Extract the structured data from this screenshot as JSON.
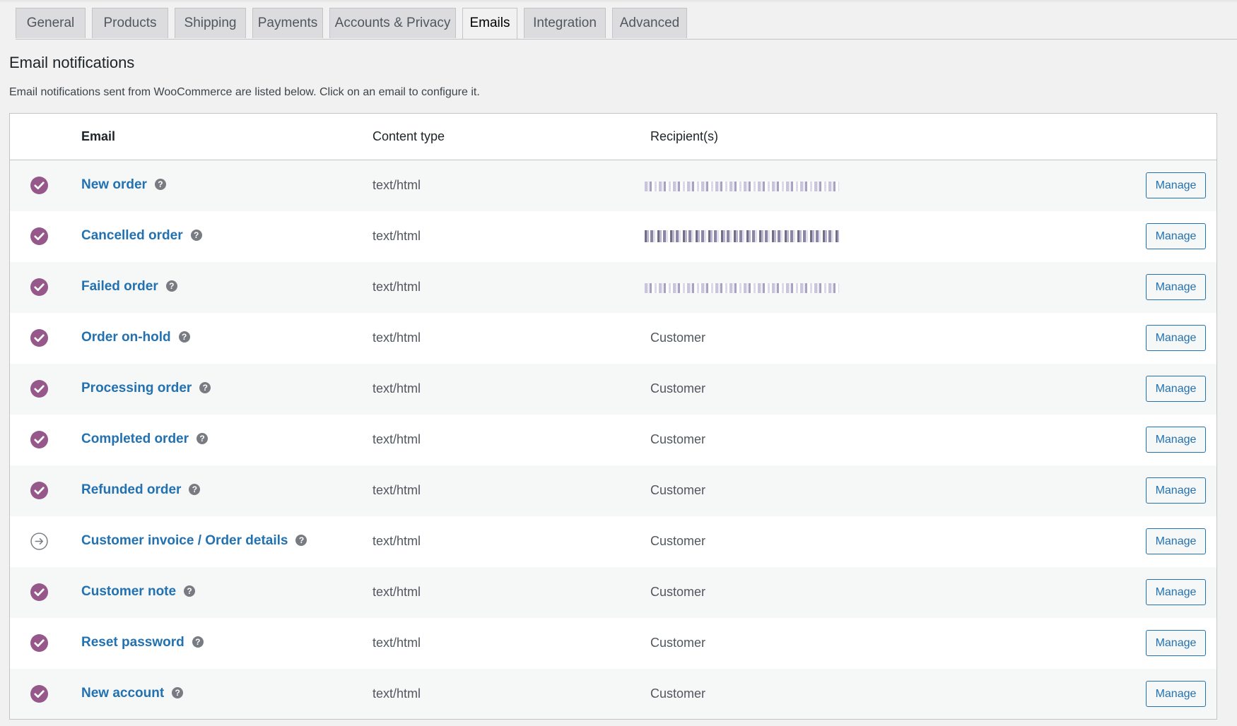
{
  "tabs": [
    {
      "label": "General"
    },
    {
      "label": "Products"
    },
    {
      "label": "Shipping"
    },
    {
      "label": "Payments"
    },
    {
      "label": "Accounts & Privacy"
    },
    {
      "label": "Emails"
    },
    {
      "label": "Integration"
    },
    {
      "label": "Advanced"
    }
  ],
  "active_tab": "Emails",
  "page": {
    "title": "Email notifications",
    "description": "Email notifications sent from WooCommerce are listed below. Click on an email to configure it."
  },
  "table": {
    "headers": {
      "email": "Email",
      "content_type": "Content type",
      "recipients": "Recipient(s)"
    },
    "help_glyph": "?",
    "manage_label": "Manage",
    "rows": [
      {
        "name": "New order",
        "status": "enabled",
        "content_type": "text/html",
        "recipient": "",
        "recipient_redacted": true
      },
      {
        "name": "Cancelled order",
        "status": "enabled",
        "content_type": "text/html",
        "recipient": "",
        "recipient_redacted": true
      },
      {
        "name": "Failed order",
        "status": "enabled",
        "content_type": "text/html",
        "recipient": "",
        "recipient_redacted": true
      },
      {
        "name": "Order on-hold",
        "status": "enabled",
        "content_type": "text/html",
        "recipient": "Customer"
      },
      {
        "name": "Processing order",
        "status": "enabled",
        "content_type": "text/html",
        "recipient": "Customer"
      },
      {
        "name": "Completed order",
        "status": "enabled",
        "content_type": "text/html",
        "recipient": "Customer"
      },
      {
        "name": "Refunded order",
        "status": "enabled",
        "content_type": "text/html",
        "recipient": "Customer"
      },
      {
        "name": "Customer invoice / Order details",
        "status": "manual",
        "content_type": "text/html",
        "recipient": "Customer"
      },
      {
        "name": "Customer note",
        "status": "enabled",
        "content_type": "text/html",
        "recipient": "Customer"
      },
      {
        "name": "Reset password",
        "status": "enabled",
        "content_type": "text/html",
        "recipient": "Customer"
      },
      {
        "name": "New account",
        "status": "enabled",
        "content_type": "text/html",
        "recipient": "Customer"
      }
    ]
  },
  "icons": {
    "enabled": "check-circle-icon",
    "manual": "arrow-circle-icon",
    "help": "help-icon"
  },
  "colors": {
    "enabled_icon": "#96588a",
    "manual_icon": "#787c82",
    "link": "#2271b1"
  }
}
